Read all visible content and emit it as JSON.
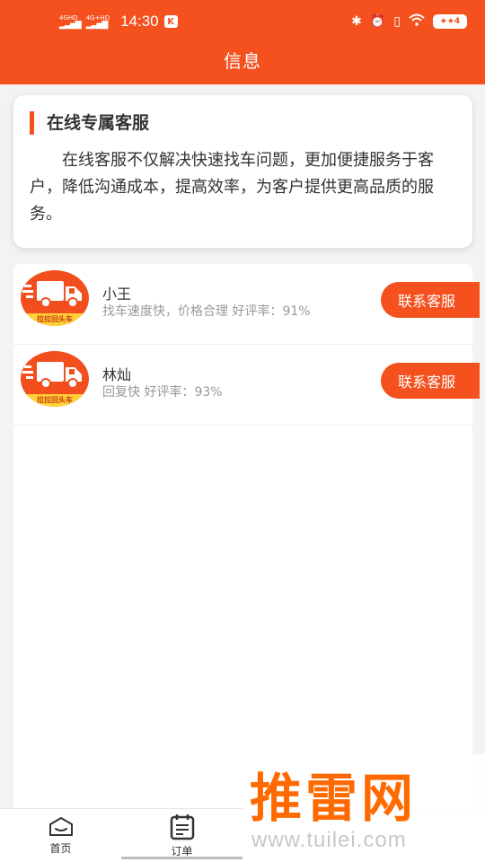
{
  "status_bar": {
    "network_1": "4GHD",
    "network_2": "4G+HD",
    "time": "14:30",
    "app_badge": "K",
    "battery_badge": "★★4"
  },
  "header": {
    "title": "信息"
  },
  "intro": {
    "title": "在线专属客服",
    "body": "在线客服不仅解决快速找车问题，更加便捷服务于客户，降低沟通成本，提高效率，为客户提供更高品质的服务。"
  },
  "agents": [
    {
      "name": "小王",
      "description": "找车速度快，价格合理 好评率：91%",
      "avatar_text": "拉拉回头车",
      "button": "联系客服"
    },
    {
      "name": "林灿",
      "description": "回复快 好评率：93%",
      "avatar_text": "拉拉回头车",
      "button": "联系客服"
    }
  ],
  "tabbar": {
    "tabs": [
      {
        "label": "首页",
        "icon": "home-icon"
      },
      {
        "label": "订单",
        "icon": "order-icon"
      }
    ]
  },
  "watermark": {
    "brand": "推雷网",
    "url": "www.tuilei.com"
  },
  "colors": {
    "accent": "#f4511e",
    "avatar_band": "#ffd338"
  }
}
